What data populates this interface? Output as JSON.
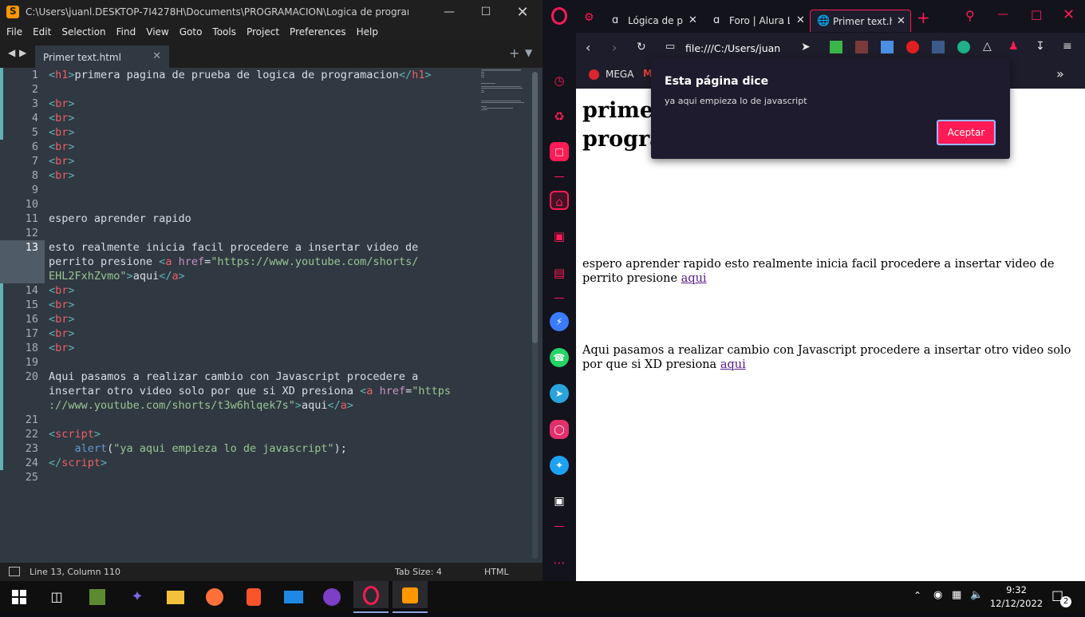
{
  "sublime": {
    "title": "C:\\Users\\juanl.DESKTOP-7I4278H\\Documents\\PROGRAMACION\\Logica de programacion\\Pri...",
    "menu": [
      "File",
      "Edit",
      "Selection",
      "Find",
      "View",
      "Goto",
      "Tools",
      "Project",
      "Preferences",
      "Help"
    ],
    "tab_label": "Primer text.html",
    "line_numbers": [
      "1",
      "2",
      "3",
      "4",
      "5",
      "6",
      "7",
      "8",
      "9",
      "10",
      "11",
      "12",
      "13",
      "",
      "",
      "14",
      "15",
      "16",
      "17",
      "18",
      "19",
      "20",
      "",
      "",
      "21",
      "22",
      "23",
      "24",
      "25"
    ],
    "status": {
      "position": "Line 13, Column 110",
      "tab_size": "Tab Size: 4",
      "syntax": "HTML"
    }
  },
  "code_text": {
    "h1_open": "<",
    "h1_tag": "h1",
    "h1_close": ">",
    "h1_text": "primera pagina de prueba de logica de programacion",
    "h1_end_open": "</",
    "h1_end_tag": "h1",
    "h1_end_close": ">",
    "br": "br",
    "line11": "espero aprender rapido",
    "line13a": "esto realmente inicia facil procedere a insertar video de",
    "line13b_text": "perrito presione ",
    "a_tag": "a",
    "href_attr": "href",
    "url1_part1": "\"https://www.youtube.com/shorts/",
    "url1_part2": "EHL2FxhZvmo\"",
    "aqui": "aqui",
    "line20a": "Aqui pasamos a realizar cambio con Javascript procedere a",
    "line20b_text": "insertar otro video solo por que si XD presiona ",
    "url2_part1": "\"https",
    "url2_part2": "://www.youtube.com/shorts/t3w6hlqek7s\"",
    "script": "script",
    "alert_fn": "alert",
    "alert_str": "\"ya aqui empieza lo de javascript\"",
    "alert_end": ");"
  },
  "opera": {
    "tabs": [
      {
        "label": "Lógica de pro",
        "icon": "a"
      },
      {
        "label": "Foro | Alura La",
        "icon": "a"
      },
      {
        "label": "Primer text.htm",
        "icon": "globe"
      }
    ],
    "address": "file:///C:/Users/juan",
    "bookmark": "MEGA",
    "page": {
      "h1": "primera pagina de prueba de logica de programacion",
      "h1_visible_1": "primer",
      "h1_visible_2": "progra",
      "p1": "espero aprender rapido esto realmente inicia facil procedere a insertar video de perrito presione",
      "link1": "aqui",
      "p2": "Aqui pasamos a realizar cambio con Javascript procedere a insertar otro video solo por que si XD presiona",
      "link2": "aqui"
    },
    "dialog": {
      "title": "Esta página dice",
      "message": "ya aqui empieza lo de javascript",
      "button": "Aceptar"
    }
  },
  "taskbar": {
    "time": "9:32",
    "date": "12/12/2022",
    "notifications": "2"
  },
  "colors": {
    "accent_opera": "#ff1b55",
    "sublime_bg": "#303841"
  }
}
